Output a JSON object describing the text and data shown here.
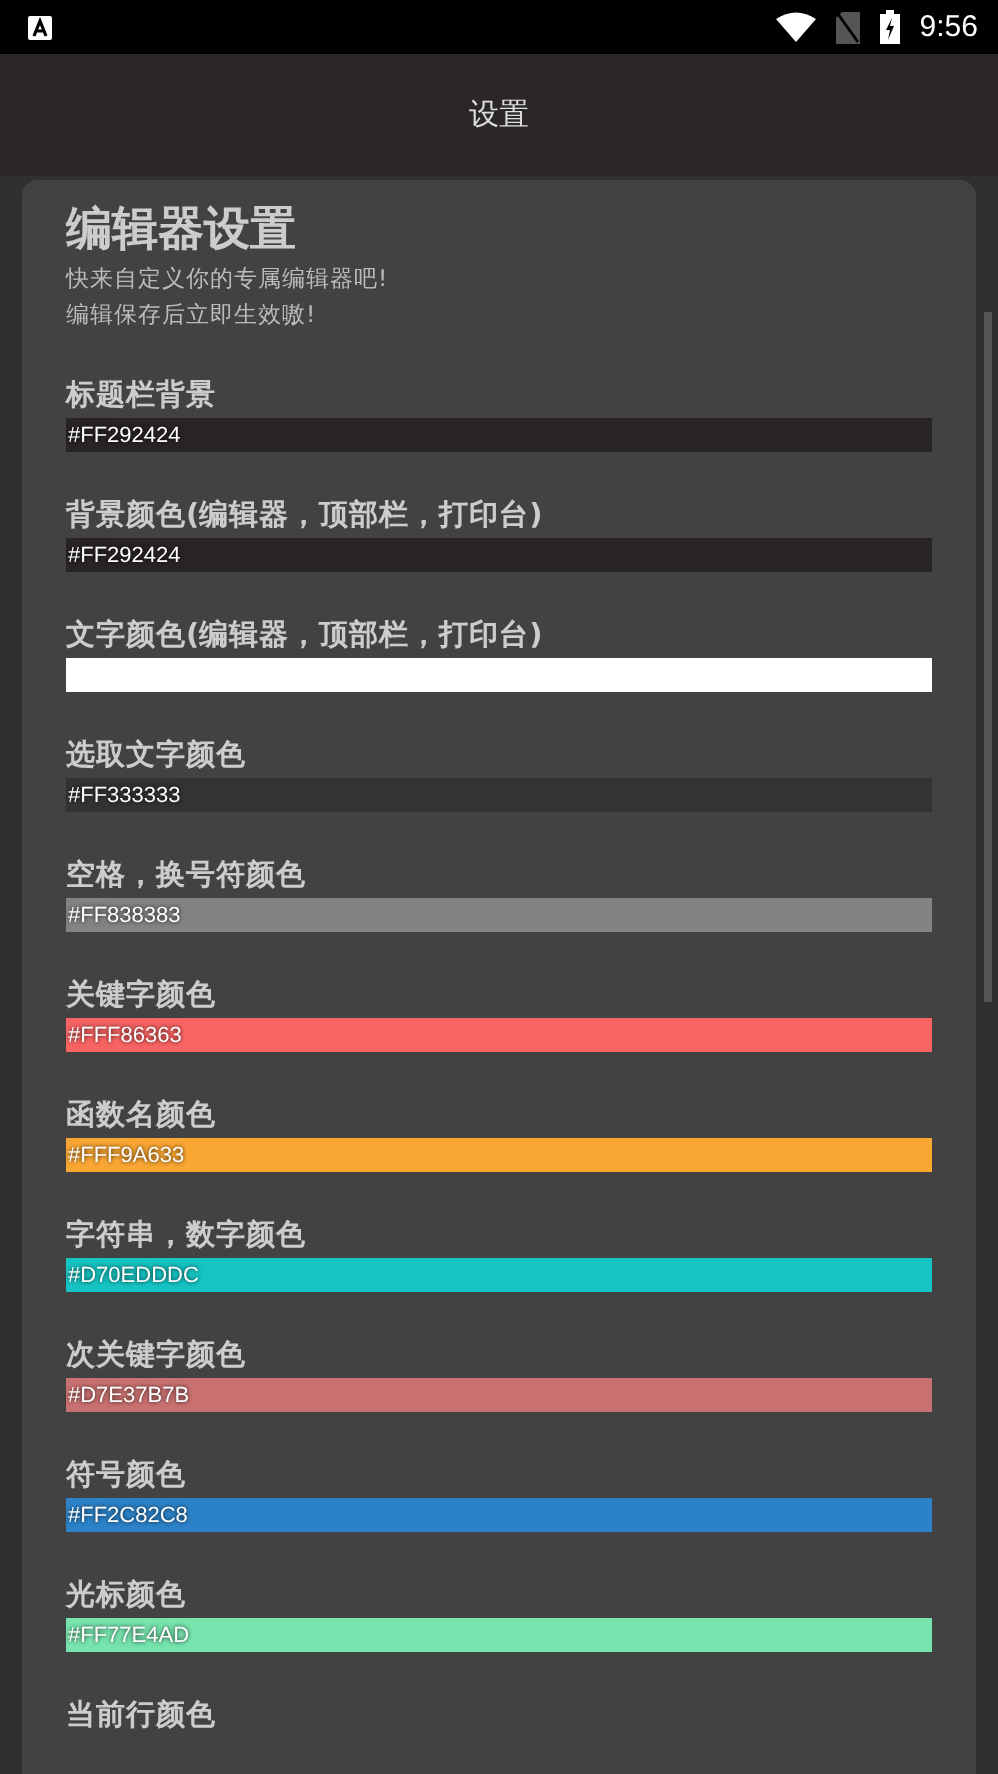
{
  "status_bar": {
    "time": "9:56"
  },
  "app_bar": {
    "title": "设置"
  },
  "section": {
    "title_large": "编辑器设置",
    "lines": [
      "快来自定义你的专属编辑器吧!",
      "编辑保存后立即生效嗷!"
    ]
  },
  "settings": [
    {
      "label": "标题栏背景",
      "value": "#FF292424",
      "color": "#292424"
    },
    {
      "label": "背景颜色(编辑器，顶部栏，打印台)",
      "value": "#FF292424",
      "color": "#292424"
    },
    {
      "label": "文字颜色(编辑器，顶部栏，打印台)",
      "color": "#ffffff"
    },
    {
      "label": "选取文字颜色",
      "value": "#FF333333",
      "color": "#333333"
    },
    {
      "label": "空格，换号符颜色",
      "value": "#FF838383",
      "color": "#838383"
    },
    {
      "label": "关键字颜色",
      "value": "#FFF86363",
      "color": "#f86363"
    },
    {
      "label": "函数名颜色",
      "value": "#FFF9A633",
      "color": "#f9a633"
    },
    {
      "label": "字符串，数字颜色",
      "value": "#D70EDDDC",
      "color": "#15c4c3"
    },
    {
      "label": "次关键字颜色",
      "value": "#D7E37B7B",
      "color": "#c97170"
    },
    {
      "label": "符号颜色",
      "value": "#FF2C82C8",
      "color": "#2c82c8"
    },
    {
      "label": "光标颜色",
      "value": "#FF77E4AD",
      "color": "#77e4ad"
    },
    {
      "label": "当前行颜色"
    }
  ]
}
